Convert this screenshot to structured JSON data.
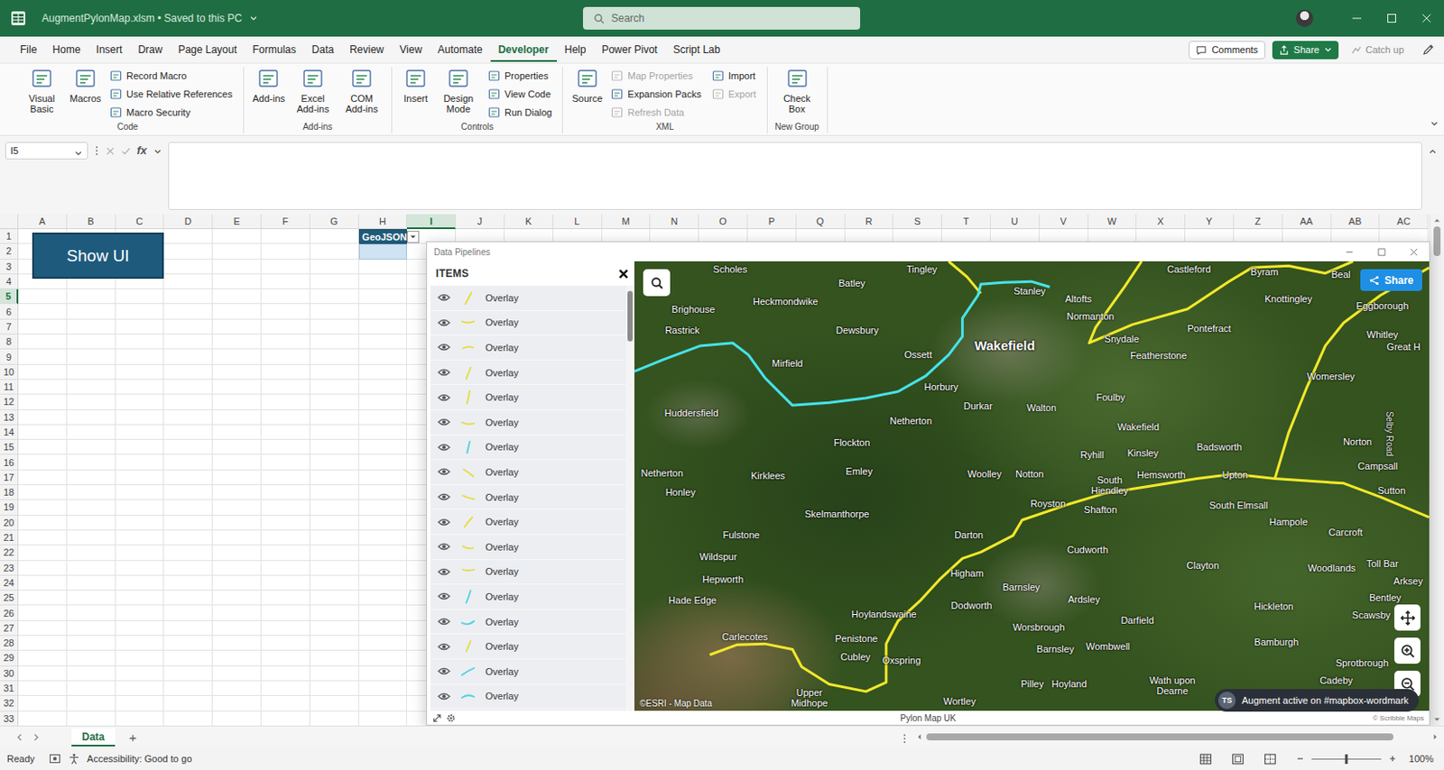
{
  "titlebar": {
    "file": "AugmentPylonMap.xlsm • Saved to this PC",
    "search": "Search"
  },
  "menu": {
    "tabs": [
      {
        "label": "File",
        "selected": false
      },
      {
        "label": "Home",
        "selected": false
      },
      {
        "label": "Insert",
        "selected": false
      },
      {
        "label": "Draw",
        "selected": false
      },
      {
        "label": "Page Layout",
        "selected": false
      },
      {
        "label": "Formulas",
        "selected": false
      },
      {
        "label": "Data",
        "selected": false
      },
      {
        "label": "Review",
        "selected": false
      },
      {
        "label": "View",
        "selected": false
      },
      {
        "label": "Automate",
        "selected": false
      },
      {
        "label": "Developer",
        "selected": true
      },
      {
        "label": "Help",
        "selected": false
      },
      {
        "label": "Power Pivot",
        "selected": false
      },
      {
        "label": "Script Lab",
        "selected": false
      }
    ],
    "comments": "Comments",
    "share": "Share",
    "catch_up": "Catch up"
  },
  "ribbon": {
    "groups": [
      {
        "label": "Code",
        "items": [
          {
            "kind": "large",
            "label": "Visual Basic",
            "disabled": false
          },
          {
            "kind": "large",
            "label": "Macros",
            "disabled": false
          },
          {
            "kind": "stack",
            "buttons": [
              {
                "label": "Record Macro",
                "disabled": false
              },
              {
                "label": "Use Relative References",
                "disabled": false
              },
              {
                "label": "Macro Security",
                "disabled": false
              }
            ]
          }
        ]
      },
      {
        "label": "Add-ins",
        "items": [
          {
            "kind": "large",
            "label": "Add-ins",
            "disabled": false
          },
          {
            "kind": "large",
            "label": "Excel Add-ins",
            "disabled": false
          },
          {
            "kind": "large",
            "label": "COM Add-ins",
            "disabled": false
          }
        ]
      },
      {
        "label": "Controls",
        "items": [
          {
            "kind": "large",
            "label": "Insert",
            "disabled": false
          },
          {
            "kind": "large",
            "label": "Design Mode",
            "disabled": false
          },
          {
            "kind": "stack",
            "buttons": [
              {
                "label": "Properties",
                "disabled": false
              },
              {
                "label": "View Code",
                "disabled": false
              },
              {
                "label": "Run Dialog",
                "disabled": false
              }
            ]
          }
        ]
      },
      {
        "label": "XML",
        "items": [
          {
            "kind": "large",
            "label": "Source",
            "disabled": false
          },
          {
            "kind": "stack",
            "buttons": [
              {
                "label": "Map Properties",
                "disabled": true
              },
              {
                "label": "Expansion Packs",
                "disabled": false
              },
              {
                "label": "Refresh Data",
                "disabled": true
              }
            ]
          },
          {
            "kind": "stack",
            "buttons": [
              {
                "label": "Import",
                "disabled": false
              },
              {
                "label": "Export",
                "disabled": true
              }
            ]
          }
        ]
      },
      {
        "label": "New Group",
        "items": [
          {
            "kind": "large",
            "label": "Check Box",
            "disabled": false
          }
        ]
      }
    ]
  },
  "formula_bar": {
    "name_box": "I5",
    "fx": "fx",
    "value": ""
  },
  "sheet": {
    "columns": [
      {
        "label": "A",
        "selected": false
      },
      {
        "label": "B",
        "selected": false
      },
      {
        "label": "C",
        "selected": false
      },
      {
        "label": "D",
        "selected": false
      },
      {
        "label": "E",
        "selected": false
      },
      {
        "label": "F",
        "selected": false
      },
      {
        "label": "G",
        "selected": false
      },
      {
        "label": "H",
        "selected": false
      },
      {
        "label": "I",
        "selected": true
      },
      {
        "label": "J",
        "selected": false
      },
      {
        "label": "K",
        "selected": false
      },
      {
        "label": "L",
        "selected": false
      },
      {
        "label": "M",
        "selected": false
      },
      {
        "label": "N",
        "selected": false
      },
      {
        "label": "O",
        "selected": false
      },
      {
        "label": "P",
        "selected": false
      },
      {
        "label": "Q",
        "selected": false
      },
      {
        "label": "R",
        "selected": false
      },
      {
        "label": "S",
        "selected": false
      },
      {
        "label": "T",
        "selected": false
      },
      {
        "label": "U",
        "selected": false
      },
      {
        "label": "V",
        "selected": false
      },
      {
        "label": "W",
        "selected": false
      },
      {
        "label": "X",
        "selected": false
      },
      {
        "label": "Y",
        "selected": false
      },
      {
        "label": "Z",
        "selected": false
      },
      {
        "label": "AA",
        "selected": false
      },
      {
        "label": "AB",
        "selected": false
      },
      {
        "label": "AC",
        "selected": false
      }
    ],
    "rows": [
      {
        "label": "1",
        "selected": false
      },
      {
        "label": "2",
        "selected": false
      },
      {
        "label": "3",
        "selected": false
      },
      {
        "label": "4",
        "selected": false
      },
      {
        "label": "5",
        "selected": true
      },
      {
        "label": "6",
        "selected": false
      },
      {
        "label": "7",
        "selected": false
      },
      {
        "label": "8",
        "selected": false
      },
      {
        "label": "9",
        "selected": false
      },
      {
        "label": "10",
        "selected": false
      },
      {
        "label": "11",
        "selected": false
      },
      {
        "label": "12",
        "selected": false
      },
      {
        "label": "13",
        "selected": false
      },
      {
        "label": "14",
        "selected": false
      },
      {
        "label": "15",
        "selected": false
      },
      {
        "label": "16",
        "selected": false
      },
      {
        "label": "17",
        "selected": false
      },
      {
        "label": "18",
        "selected": false
      },
      {
        "label": "19",
        "selected": false
      },
      {
        "label": "20",
        "selected": false
      },
      {
        "label": "21",
        "selected": false
      },
      {
        "label": "22",
        "selected": false
      },
      {
        "label": "23",
        "selected": false
      },
      {
        "label": "24",
        "selected": false
      },
      {
        "label": "25",
        "selected": false
      },
      {
        "label": "26",
        "selected": false
      },
      {
        "label": "27",
        "selected": false
      },
      {
        "label": "28",
        "selected": false
      },
      {
        "label": "29",
        "selected": false
      },
      {
        "label": "30",
        "selected": false
      },
      {
        "label": "31",
        "selected": false
      },
      {
        "label": "32",
        "selected": false
      },
      {
        "label": "33",
        "selected": false
      }
    ],
    "button": "Show UI",
    "table": {
      "header": "GeoJSON"
    },
    "vscroll_level": 0.06,
    "hscroll_level": 0.93
  },
  "dialog": {
    "title": "Data Pipelines",
    "items_title": "ITEMS",
    "items_scroll_level": 0.12,
    "items": [
      {
        "label": "Overlay",
        "visible": true,
        "color": "#e6dc3c"
      },
      {
        "label": "Overlay",
        "visible": true,
        "color": "#e6dc3c"
      },
      {
        "label": "Overlay",
        "visible": true,
        "color": "#e6dc3c"
      },
      {
        "label": "Overlay",
        "visible": true,
        "color": "#e6dc3c"
      },
      {
        "label": "Overlay",
        "visible": true,
        "color": "#e6dc3c"
      },
      {
        "label": "Overlay",
        "visible": true,
        "color": "#e6dc3c"
      },
      {
        "label": "Overlay",
        "visible": true,
        "color": "#4fd3dc"
      },
      {
        "label": "Overlay",
        "visible": true,
        "color": "#e6dc3c"
      },
      {
        "label": "Overlay",
        "visible": true,
        "color": "#e6dc3c"
      },
      {
        "label": "Overlay",
        "visible": true,
        "color": "#e6dc3c"
      },
      {
        "label": "Overlay",
        "visible": true,
        "color": "#e6dc3c"
      },
      {
        "label": "Overlay",
        "visible": true,
        "color": "#e6dc3c"
      },
      {
        "label": "Overlay",
        "visible": true,
        "color": "#4fd3dc"
      },
      {
        "label": "Overlay",
        "visible": true,
        "color": "#4fd3dc"
      },
      {
        "label": "Overlay",
        "visible": true,
        "color": "#e6dc3c"
      },
      {
        "label": "Overlay",
        "visible": true,
        "color": "#4fd3dc"
      },
      {
        "label": "Overlay",
        "visible": true,
        "color": "#4fd3dc"
      }
    ],
    "map": {
      "share": "Share",
      "attribution": "©ESRI - Map Data",
      "labels": [
        {
          "text": "Scholes",
          "kind": "town"
        },
        {
          "text": "Tingley",
          "kind": "town"
        },
        {
          "text": "Castleford",
          "kind": "town"
        },
        {
          "text": "Byram",
          "kind": "town"
        },
        {
          "text": "Beal",
          "kind": "town"
        },
        {
          "text": "Batley",
          "kind": "town"
        },
        {
          "text": "Heckmondwike",
          "kind": "town"
        },
        {
          "text": "Stanley",
          "kind": "town"
        },
        {
          "text": "Altofts",
          "kind": "town"
        },
        {
          "text": "Knottingley",
          "kind": "town"
        },
        {
          "text": "Eggborough",
          "kind": "town"
        },
        {
          "text": "Brighouse",
          "kind": "town"
        },
        {
          "text": "Normanton",
          "kind": "town"
        },
        {
          "text": "Rastrick",
          "kind": "town"
        },
        {
          "text": "Dewsbury",
          "kind": "town"
        },
        {
          "text": "Pontefract",
          "kind": "town"
        },
        {
          "text": "Whitley",
          "kind": "town"
        },
        {
          "text": "Snydale",
          "kind": "town"
        },
        {
          "text": "Great H",
          "kind": "town"
        },
        {
          "text": "Wakefield",
          "kind": "city"
        },
        {
          "text": "Ossett",
          "kind": "town"
        },
        {
          "text": "Featherstone",
          "kind": "town"
        },
        {
          "text": "Mirfield",
          "kind": "town"
        },
        {
          "text": "Womersley",
          "kind": "town"
        },
        {
          "text": "Horbury",
          "kind": "town"
        },
        {
          "text": "Foulby",
          "kind": "town"
        },
        {
          "text": "Durkar",
          "kind": "town"
        },
        {
          "text": "Walton",
          "kind": "town"
        },
        {
          "text": "Huddersfield",
          "kind": "town"
        },
        {
          "text": "Netherton",
          "kind": "town"
        },
        {
          "text": "Wakefield",
          "kind": "town"
        },
        {
          "text": "Selby Road",
          "kind": "road"
        },
        {
          "text": "Norton",
          "kind": "town"
        },
        {
          "text": "Flockton",
          "kind": "town"
        },
        {
          "text": "Badsworth",
          "kind": "town"
        },
        {
          "text": "Kinsley",
          "kind": "town"
        },
        {
          "text": "Ryhill",
          "kind": "town"
        },
        {
          "text": "Campsall",
          "kind": "town"
        },
        {
          "text": "Emley",
          "kind": "town"
        },
        {
          "text": "Netherton",
          "kind": "town"
        },
        {
          "text": "Woolley",
          "kind": "town"
        },
        {
          "text": "Notton",
          "kind": "town"
        },
        {
          "text": "Hemsworth",
          "kind": "town"
        },
        {
          "text": "Upton",
          "kind": "town"
        },
        {
          "text": "Kirklees",
          "kind": "town"
        },
        {
          "text": "South Hiendley",
          "kind": "stacked"
        },
        {
          "text": "Sutton",
          "kind": "town"
        },
        {
          "text": "Honley",
          "kind": "town"
        },
        {
          "text": "Royston",
          "kind": "town"
        },
        {
          "text": "South Elmsall",
          "kind": "town"
        },
        {
          "text": "Shafton",
          "kind": "town"
        },
        {
          "text": "Skelmanthorpe",
          "kind": "town"
        },
        {
          "text": "Hampole",
          "kind": "town"
        },
        {
          "text": "Carcroft",
          "kind": "town"
        },
        {
          "text": "Fulstone",
          "kind": "town"
        },
        {
          "text": "Darton",
          "kind": "town"
        },
        {
          "text": "Cudworth",
          "kind": "town"
        },
        {
          "text": "Wildspur",
          "kind": "town"
        },
        {
          "text": "Toll Bar",
          "kind": "town"
        },
        {
          "text": "Clayton",
          "kind": "town"
        },
        {
          "text": "Woodlands",
          "kind": "town"
        },
        {
          "text": "Higham",
          "kind": "town"
        },
        {
          "text": "Hepworth",
          "kind": "town"
        },
        {
          "text": "Arksey",
          "kind": "town"
        },
        {
          "text": "Barnsley",
          "kind": "town"
        },
        {
          "text": "Bentley",
          "kind": "town"
        },
        {
          "text": "Ardsley",
          "kind": "town"
        },
        {
          "text": "Hade Edge",
          "kind": "town"
        },
        {
          "text": "Dodworth",
          "kind": "town"
        },
        {
          "text": "Hickleton",
          "kind": "town"
        },
        {
          "text": "Hoylandswaine",
          "kind": "town"
        },
        {
          "text": "Scawsby",
          "kind": "town"
        },
        {
          "text": "Darfield",
          "kind": "town"
        },
        {
          "text": "Worsbrough",
          "kind": "town"
        },
        {
          "text": "Carlecotes",
          "kind": "town"
        },
        {
          "text": "Penistone",
          "kind": "town"
        },
        {
          "text": "Bamburgh",
          "kind": "town"
        },
        {
          "text": "Wombwell",
          "kind": "town"
        },
        {
          "text": "Barnsley",
          "kind": "town"
        },
        {
          "text": "Cubley",
          "kind": "town"
        },
        {
          "text": "Oxspring",
          "kind": "town"
        },
        {
          "text": "Sprotbrough",
          "kind": "town"
        },
        {
          "text": "Pilley",
          "kind": "town"
        },
        {
          "text": "Hoyland",
          "kind": "town"
        },
        {
          "text": "Wath upon Dearne",
          "kind": "stacked"
        },
        {
          "text": "Cadeby",
          "kind": "town"
        },
        {
          "text": "Upper Midhope",
          "kind": "stacked"
        },
        {
          "text": "Wortley",
          "kind": "town"
        }
      ]
    },
    "footer": "Pylon Map UK",
    "credit": "© Scribble Maps"
  },
  "toast": {
    "initials": "TS",
    "text": "Augment active on #mapbox-wordmark"
  },
  "sheet_tabs": {
    "tabs": [
      {
        "label": "Data",
        "selected": true
      }
    ],
    "add": "+"
  },
  "status": {
    "ready": "Ready",
    "accessibility": "Accessibility: Good to go",
    "zoom": "100%",
    "zoom_level": 0.5
  }
}
